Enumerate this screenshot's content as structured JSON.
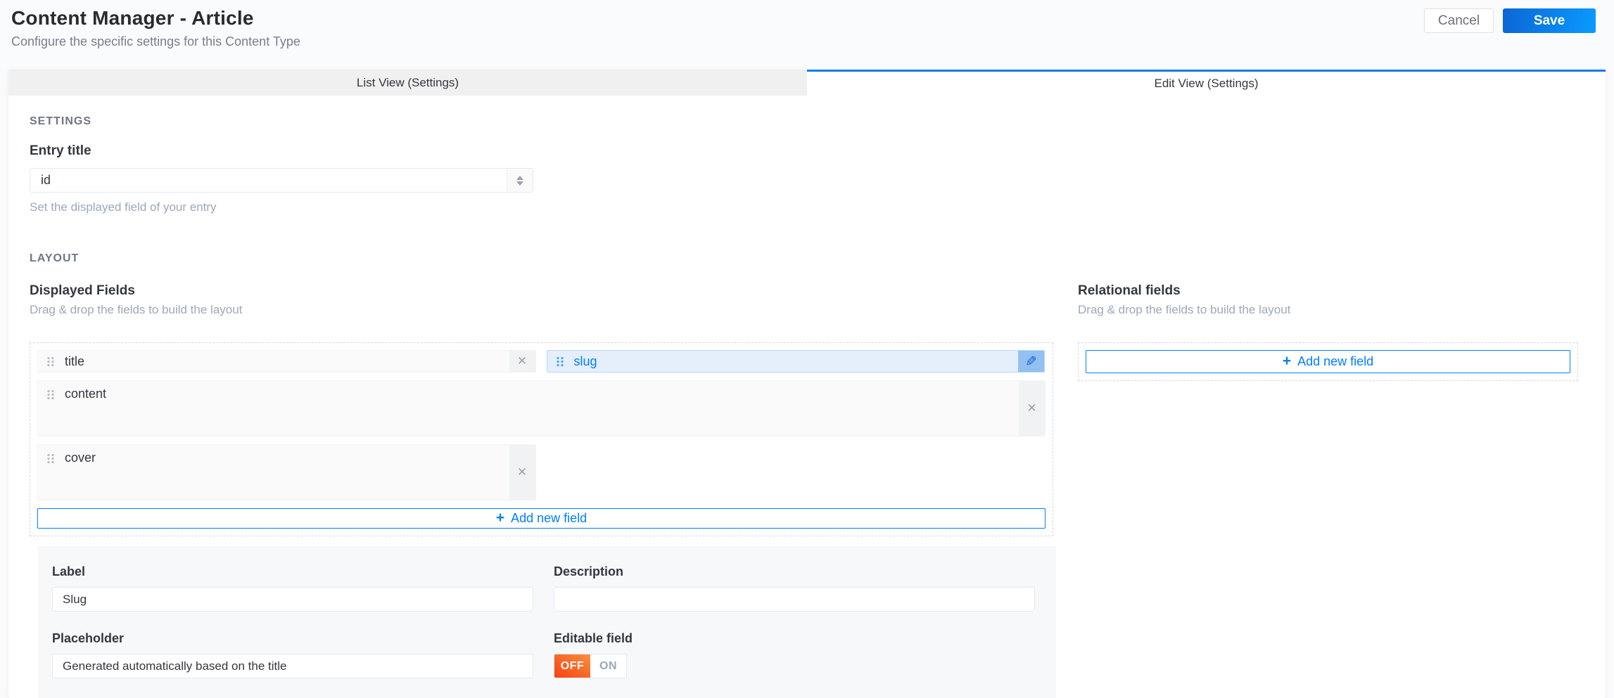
{
  "header": {
    "title": "Content Manager - Article",
    "subtitle": "Configure the specific settings for this Content Type",
    "cancel_label": "Cancel",
    "save_label": "Save"
  },
  "tabs": [
    {
      "label": "List View (Settings)",
      "active": false
    },
    {
      "label": "Edit View (Settings)",
      "active": true
    }
  ],
  "settings_section": {
    "heading": "SETTINGS",
    "entry_title": {
      "label": "Entry title",
      "value": "id",
      "help": "Set the displayed field of your entry"
    }
  },
  "layout_section": {
    "heading": "LAYOUT",
    "displayed_fields": {
      "title": "Displayed Fields",
      "subtitle": "Drag & drop the fields to build the layout",
      "fields": [
        {
          "name": "title",
          "size": "half",
          "tall": false,
          "selected": false
        },
        {
          "name": "slug",
          "size": "half",
          "tall": false,
          "selected": true
        },
        {
          "name": "content",
          "size": "full",
          "tall": true,
          "selected": false
        },
        {
          "name": "cover",
          "size": "half",
          "tall": true,
          "selected": false
        }
      ],
      "add_button": "Add new field"
    },
    "relational_fields": {
      "title": "Relational fields",
      "subtitle": "Drag & drop the fields to build the layout",
      "add_button": "Add new field"
    }
  },
  "field_form": {
    "label": {
      "label": "Label",
      "value": "Slug"
    },
    "description": {
      "label": "Description",
      "value": ""
    },
    "placeholder": {
      "label": "Placeholder",
      "value": "Generated automatically based on the title"
    },
    "editable": {
      "label": "Editable field",
      "off_label": "OFF",
      "on_label": "ON",
      "value": "OFF"
    }
  },
  "icons": {
    "remove": "✕",
    "edit": "✎",
    "plus": "+"
  },
  "colors": {
    "accent_blue": "#007eff",
    "active_tab_border": "#0e7de8",
    "save_gradient_start": "#0b66d5",
    "save_gradient_end": "#0a9bff",
    "selected_field_bg": "#e4effb",
    "selected_field_border": "#b8d7f8",
    "toggle_off_gradient_start": "#f54013",
    "toggle_off_gradient_end": "#fa913f"
  }
}
